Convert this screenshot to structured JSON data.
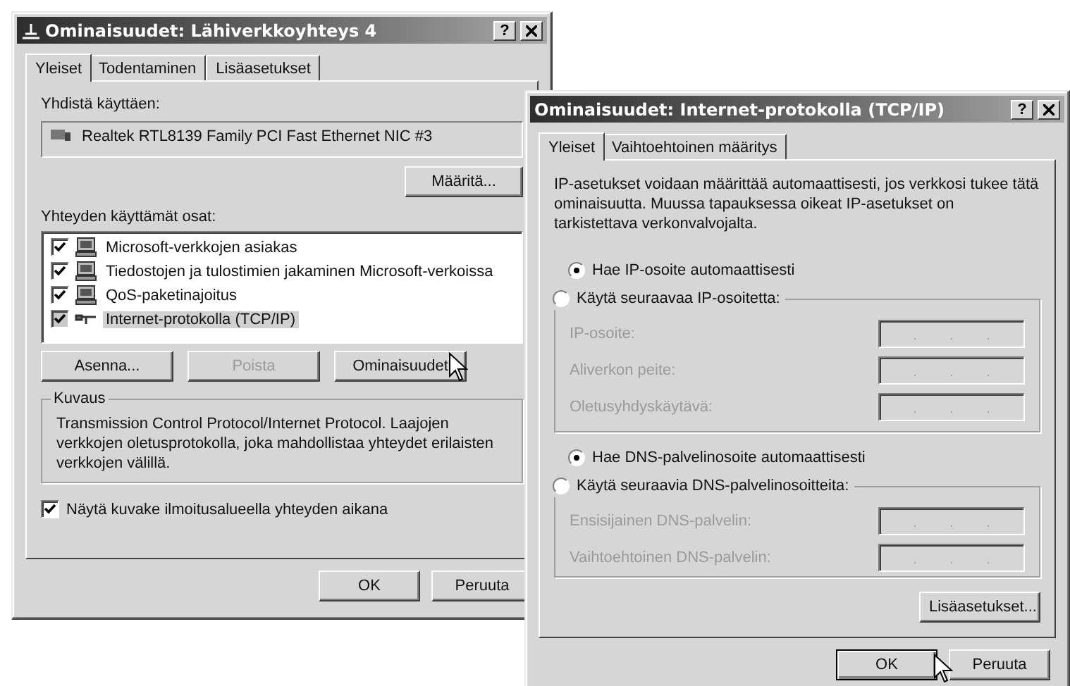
{
  "connection_window": {
    "title": "Ominaisuudet: Lähiverkkoyhteys 4",
    "help": "?",
    "tabs": [
      {
        "label": "Yleiset",
        "selected": true
      },
      {
        "label": "Todentaminen",
        "selected": false
      },
      {
        "label": "Lisäasetukset",
        "selected": false
      }
    ],
    "connect_using_label": "Yhdistä käyttäen:",
    "adapter": "Realtek RTL8139 Family PCI Fast Ethernet NIC #3",
    "configure_button": "Määritä...",
    "components_label": "Yhteyden käyttämät osat:",
    "components": [
      {
        "kind": "computer",
        "label": "Microsoft-verkkojen asiakas",
        "checked": true,
        "selected": false
      },
      {
        "kind": "computer",
        "label": "Tiedostojen ja tulostimien jakaminen Microsoft-verkoissa",
        "checked": true,
        "selected": false
      },
      {
        "kind": "computer",
        "label": "QoS-paketinajoitus",
        "checked": true,
        "selected": false
      },
      {
        "kind": "protocol",
        "label": "Internet-protokolla (TCP/IP)",
        "checked": true,
        "selected": true
      }
    ],
    "action_buttons": [
      {
        "label": "Asenna...",
        "disabled": false
      },
      {
        "label": "Poista",
        "disabled": true
      },
      {
        "label": "Ominaisuudet",
        "disabled": false
      }
    ],
    "description_title": "Kuvaus",
    "description": "Transmission Control Protocol/Internet Protocol. Laajojen verkkojen oletusprotokolla, joka mahdollistaa yhteydet erilaisten verkkojen välillä.",
    "show_icon": {
      "label": "Näytä kuvake ilmoitusalueella yhteyden aikana",
      "checked": true
    },
    "footer_buttons": [
      {
        "label": "OK",
        "default": false
      },
      {
        "label": "Peruuta",
        "default": false
      }
    ]
  },
  "tcpip_window": {
    "title": "Ominaisuudet: Internet-protokolla (TCP/IP)",
    "help": "?",
    "tabs": [
      {
        "label": "Yleiset",
        "selected": true
      },
      {
        "label": "Vaihtoehtoinen määritys",
        "selected": false
      }
    ],
    "intro": "IP-asetukset voidaan määrittää automaattisesti, jos verkkosi tukee tätä ominaisuutta. Muussa tapauksessa oikeat IP-asetukset on tarkistettava verkonvalvojalta.",
    "ip_auto": {
      "label": "Hae IP-osoite automaattisesti",
      "selected": true
    },
    "ip_manual": {
      "label": "Käytä seuraavaa IP-osoitetta:",
      "selected": false
    },
    "ip_fields": [
      {
        "label": "IP-osoite:",
        "disabled": true,
        "separators": [
          ".",
          ".",
          "."
        ]
      },
      {
        "label": "Aliverkon peite:",
        "disabled": true,
        "separators": [
          ".",
          ".",
          "."
        ]
      },
      {
        "label": "Oletusyhdyskäytävä:",
        "disabled": true,
        "separators": [
          ".",
          ".",
          "."
        ]
      }
    ],
    "dns_auto": {
      "label": "Hae DNS-palvelinosoite automaattisesti",
      "selected": true
    },
    "dns_manual": {
      "label": "Käytä seuraavia DNS-palvelinosoitteita:",
      "selected": false
    },
    "dns_fields": [
      {
        "label": "Ensisijainen DNS-palvelin:",
        "disabled": true,
        "separators": [
          ".",
          ".",
          "."
        ]
      },
      {
        "label": "Vaihtoehtoinen DNS-palvelin:",
        "disabled": true,
        "separators": [
          ".",
          ".",
          "."
        ]
      }
    ],
    "advanced_button": "Lisäasetukset...",
    "footer_buttons": [
      {
        "label": "OK",
        "default": true
      },
      {
        "label": "Peruuta",
        "default": false
      }
    ]
  }
}
